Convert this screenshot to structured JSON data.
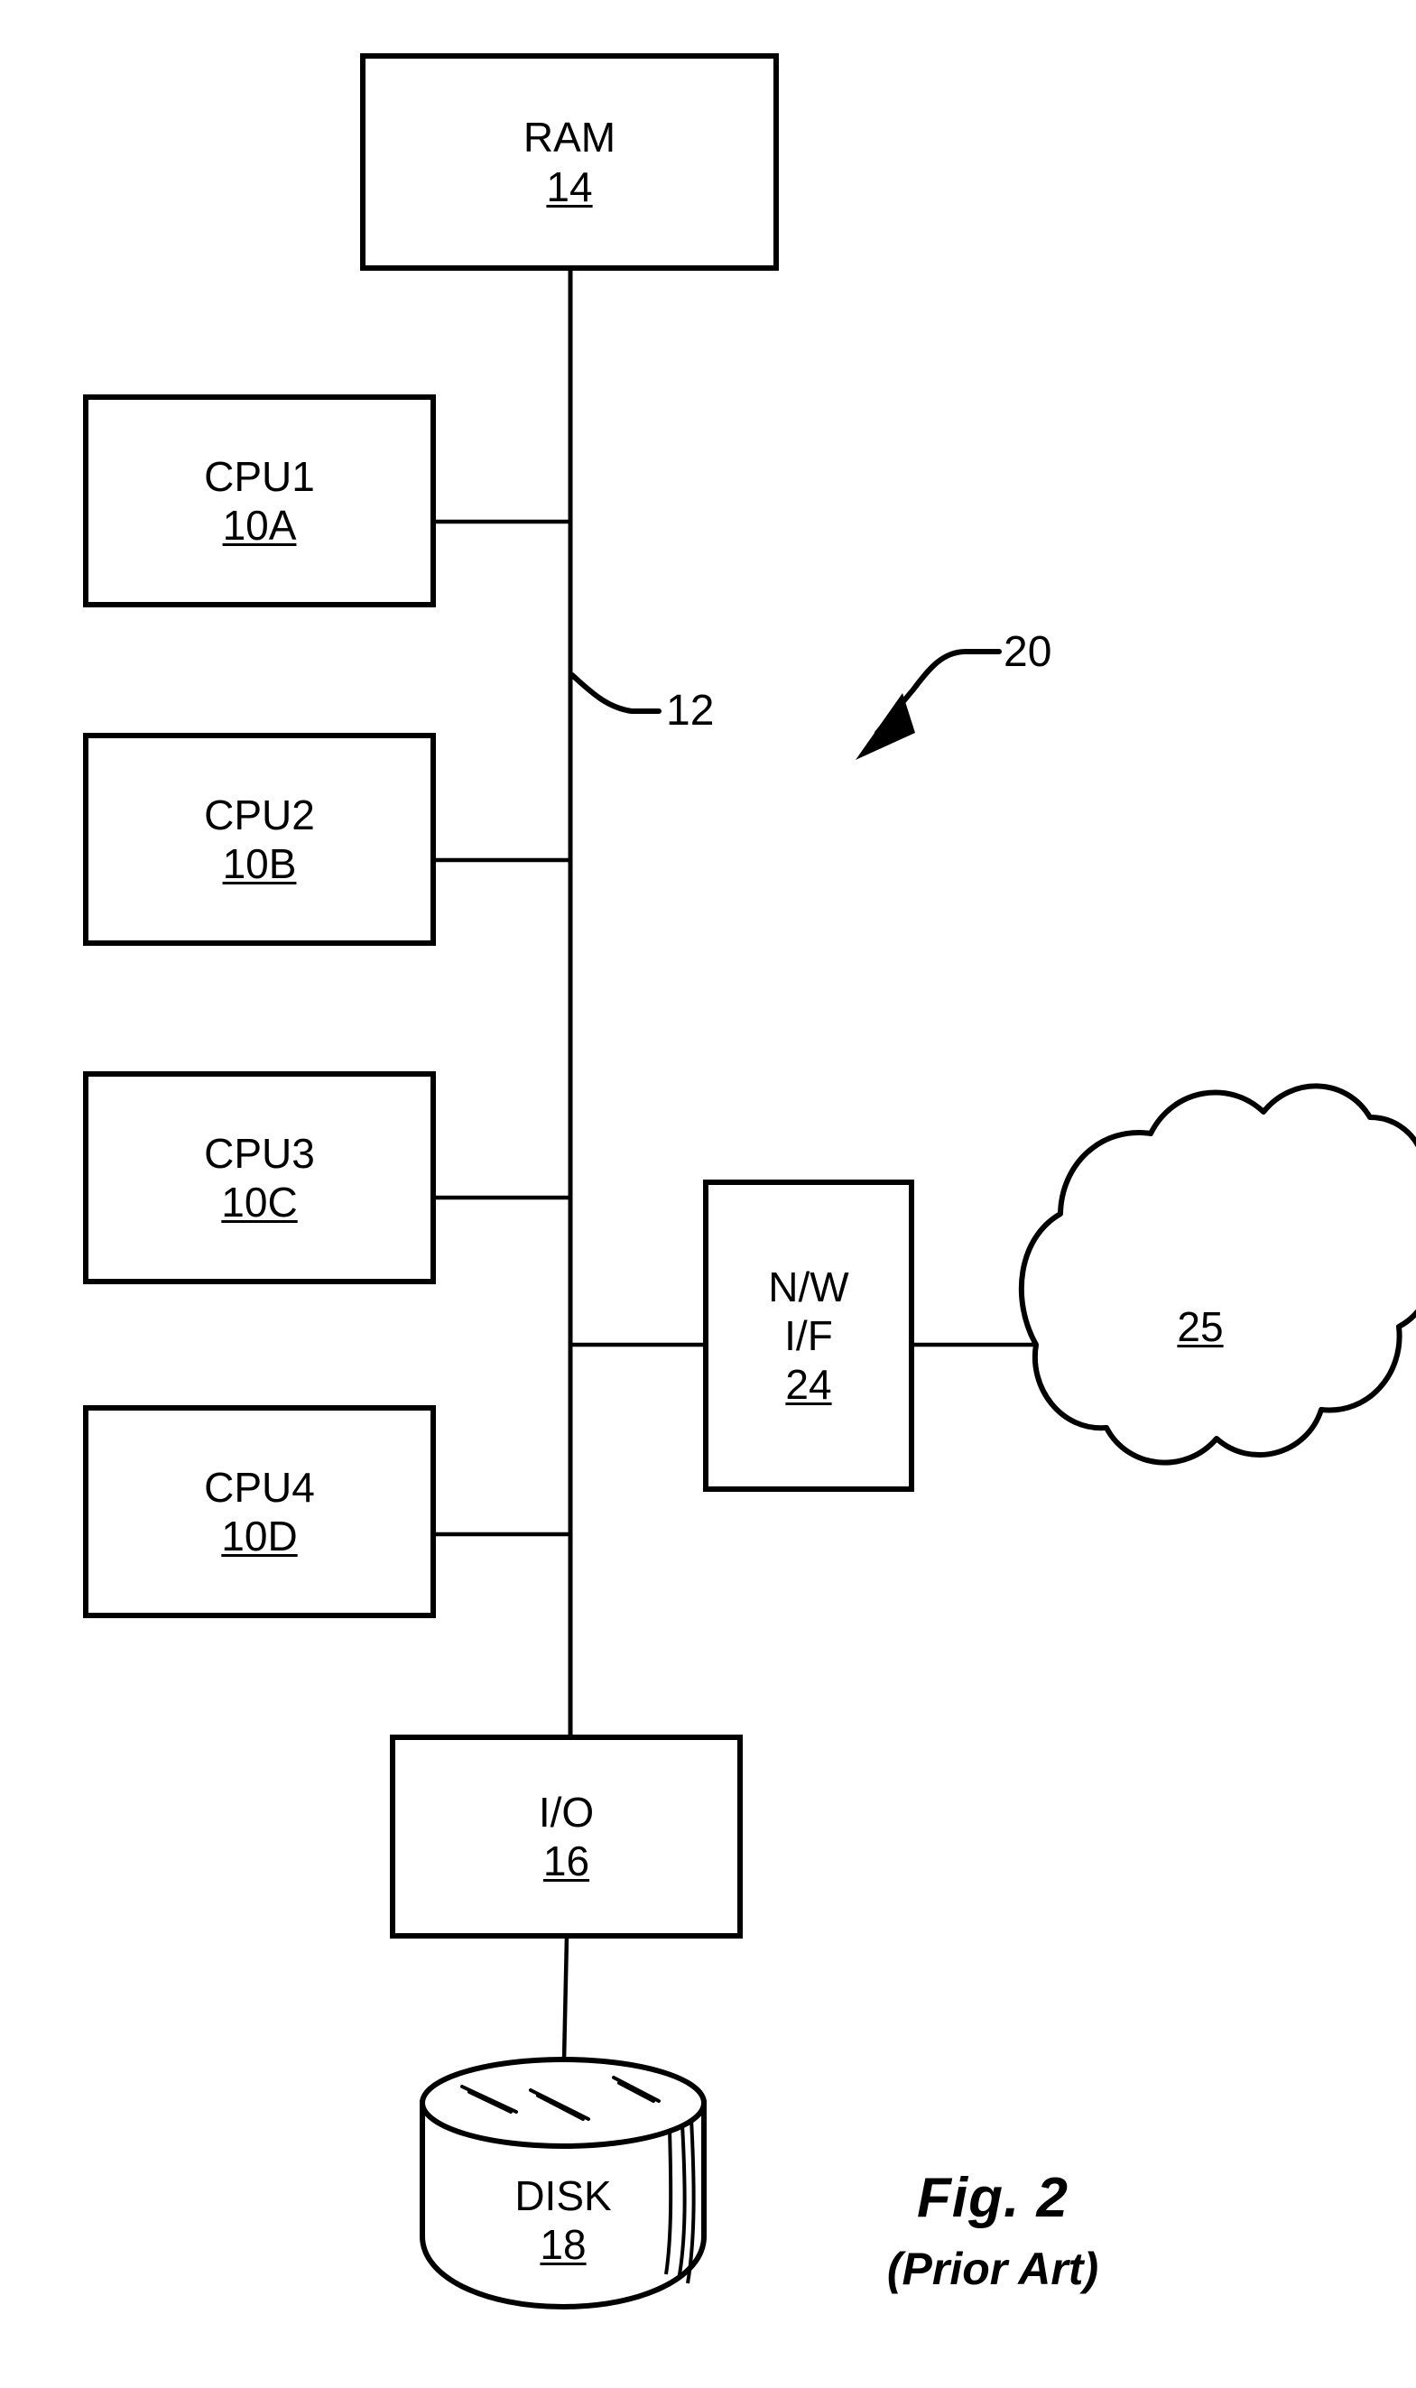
{
  "figure": {
    "caption_title": "Fig. 2",
    "caption_subtitle": "(Prior Art)",
    "stroke_color": "#000000",
    "background_color": "#ffffff"
  },
  "blocks": {
    "ram": {
      "name": "RAM",
      "ref": "14"
    },
    "cpu1": {
      "name": "CPU1",
      "ref": "10A"
    },
    "cpu2": {
      "name": "CPU2",
      "ref": "10B"
    },
    "cpu3": {
      "name": "CPU3",
      "ref": "10C"
    },
    "cpu4": {
      "name": "CPU4",
      "ref": "10D"
    },
    "network_interface": {
      "line1": "N/W",
      "line2": "I/F",
      "ref": "24"
    },
    "io": {
      "name": "I/O",
      "ref": "16"
    },
    "disk": {
      "name": "DISK",
      "ref": "18"
    },
    "network_cloud": {
      "ref": "25"
    }
  },
  "callouts": {
    "bus": "12",
    "system": "20"
  }
}
